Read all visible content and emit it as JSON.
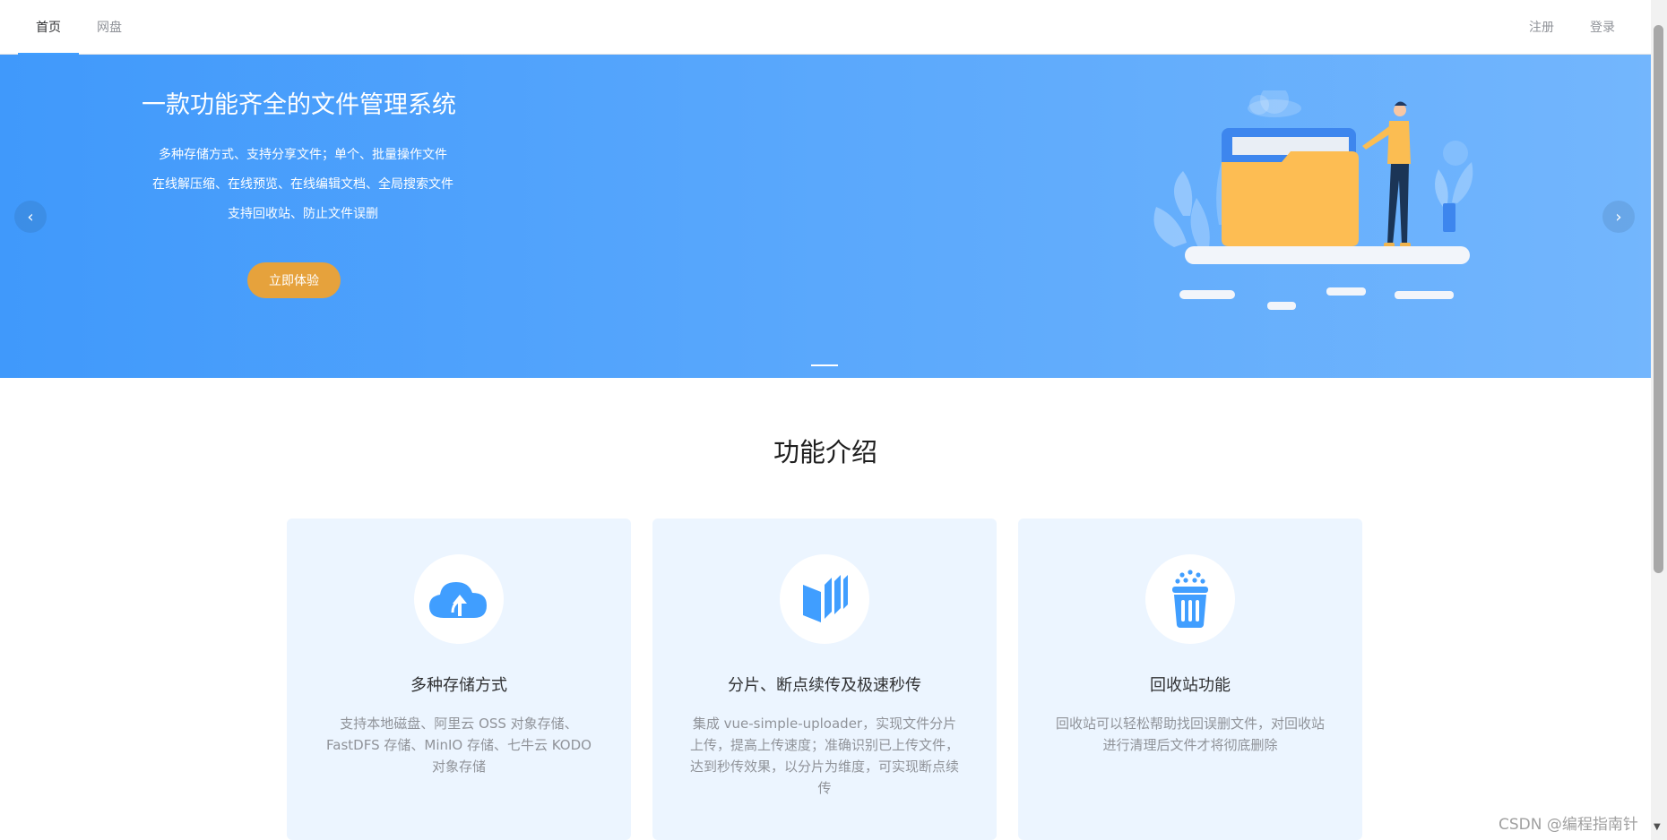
{
  "nav": {
    "tabs": [
      {
        "label": "首页",
        "active": true
      },
      {
        "label": "网盘",
        "active": false
      }
    ],
    "register_label": "注册",
    "login_label": "登录"
  },
  "banner": {
    "title": "一款功能齐全的文件管理系统",
    "lines": [
      "多种存储方式、支持分享文件；单个、批量操作文件",
      "在线解压缩、在线预览、在线编辑文档、全局搜索文件",
      "支持回收站、防止文件误删"
    ],
    "cta_label": "立即体验",
    "prev_arrow": "‹",
    "next_arrow": "›",
    "colors": {
      "gradient_start": "#4099fb",
      "gradient_end": "#73b6fd",
      "cta": "#e6a23c"
    }
  },
  "features": {
    "title": "功能介绍",
    "cards": [
      {
        "icon": "cloud-upload-icon",
        "title": "多种存储方式",
        "desc": "支持本地磁盘、阿里云 OSS 对象存储、FastDFS 存储、MinIO 存储、七牛云 KODO 对象存储"
      },
      {
        "icon": "file-chunks-icon",
        "title": "分片、断点续传及极速秒传",
        "desc": "集成 vue-simple-uploader，实现文件分片上传，提高上传速度；准确识别已上传文件，达到秒传效果，以分片为维度，可实现断点续传"
      },
      {
        "icon": "recycle-bin-icon",
        "title": "回收站功能",
        "desc": "回收站可以轻松帮助找回误删文件，对回收站进行清理后文件才将彻底删除"
      }
    ],
    "accent": "#409eff",
    "card_bg": "#ecf5ff"
  },
  "watermark": "CSDN @编程指南针"
}
